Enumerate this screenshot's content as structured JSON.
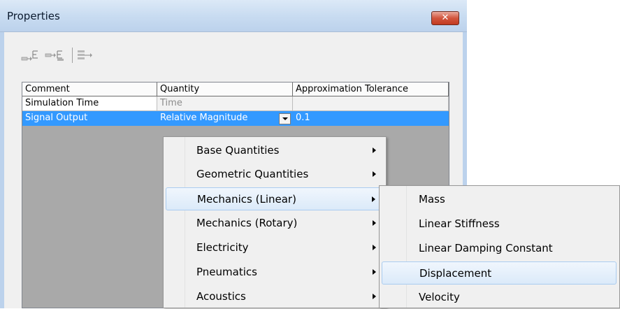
{
  "window": {
    "title": "Properties",
    "close_label": "✕"
  },
  "toolbar": {
    "icons": [
      "add-comment-icon",
      "add-element-icon",
      "export-icon"
    ]
  },
  "grid": {
    "columns": [
      "Comment",
      "Quantity",
      "Approximation Tolerance"
    ],
    "rows": [
      {
        "comment": "Simulation Time",
        "quantity": "Time",
        "tolerance": ""
      },
      {
        "comment": "Signal Output",
        "quantity": "Relative Magnitude",
        "tolerance": "0.1"
      }
    ]
  },
  "menu": {
    "items": [
      {
        "label": "Base Quantities",
        "has_submenu": true
      },
      {
        "label": "Geometric Quantities",
        "has_submenu": true
      },
      {
        "label": "Mechanics (Linear)",
        "has_submenu": true,
        "highlighted": true
      },
      {
        "label": "Mechanics (Rotary)",
        "has_submenu": true
      },
      {
        "label": "Electricity",
        "has_submenu": true
      },
      {
        "label": "Pneumatics",
        "has_submenu": true
      },
      {
        "label": "Acoustics",
        "has_submenu": true
      }
    ]
  },
  "submenu": {
    "items": [
      {
        "label": "Mass"
      },
      {
        "label": "Linear Stiffness"
      },
      {
        "label": "Linear Damping Constant"
      },
      {
        "label": "Displacement",
        "highlighted": true
      },
      {
        "label": "Velocity"
      }
    ]
  }
}
